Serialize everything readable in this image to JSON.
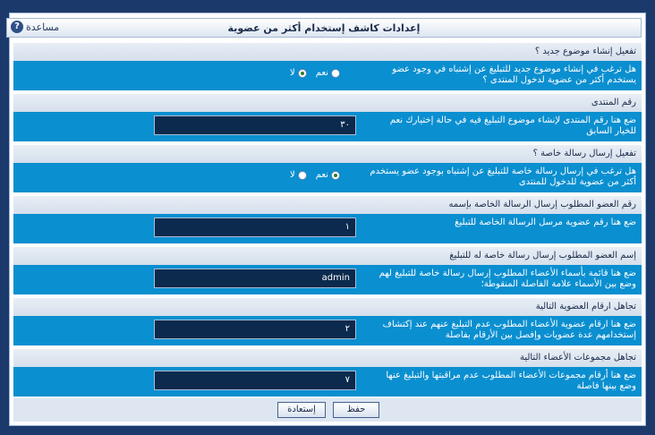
{
  "title": "إعدادات كاشف إستخدام أكثر من عضوية",
  "help_label": "مساعدة",
  "sections": [
    {
      "header": "تفعيل إنشاء موضوع جديد ؟",
      "desc": "هل ترغب في إنشاء موضوع جديد للتبليغ عن إشتباه في وجود عضو يستخدم أكثر من عضوية لدخول المنتدى ؟",
      "radio_yes": "نعم",
      "radio_no": "لا",
      "selected": "no"
    },
    {
      "header": "رقم المنتدى",
      "desc": "ضع هنا رقم المنتدى لإنشاء موضوع التبليغ فيه في حالة إختيارك نعم للخيار السابق",
      "value": "٣٠"
    },
    {
      "header": "تفعيل إرسال رسالة خاصة ؟",
      "desc": "هل ترغب في إرسال رسالة خاصة للتبليغ عن إشتباه بوجود عضو يستخدم أكثر من عضوية للدخول للمنتدى",
      "radio_yes": "نعم",
      "radio_no": "لا",
      "selected": "yes"
    },
    {
      "header": "رقم العضو المطلوب إرسال الرسالة الخاصة بإسمه",
      "desc": "ضع هنا رقم عضوية مرسل الرسالة الخاصة للتبليغ",
      "value": "١"
    },
    {
      "header": "إسم العضو المطلوب إرسال رسالة خاصة له للتبليغ",
      "desc": "ضع هنا قائمة بأسماء الأعضاء المطلوب إرسال رسالة خاصة للتبليغ لهم وضع بين الأسماء علامة الفاصلة المنقوطة؛",
      "value": "admin"
    },
    {
      "header": "تجاهل ارقام العضوية التالية",
      "desc": "ضع هنا ارقام عضوية الأعضاء المطلوب عدم التبليغ عنهم عند إكتشاف إستخدامهم عدة عضويات وإفصل بين الأرقام بفاصلة",
      "value": "٢"
    },
    {
      "header": "تجاهل مجموعات الأعضاء التالية",
      "desc": "ضع هنا أرقام مجموعات الأعضاء المطلوب عدم مراقبتها والتبليغ عنها وضع بينها فاصلة",
      "value": "٧"
    }
  ],
  "buttons": {
    "save": "حفظ",
    "reset": "إستعادة"
  }
}
